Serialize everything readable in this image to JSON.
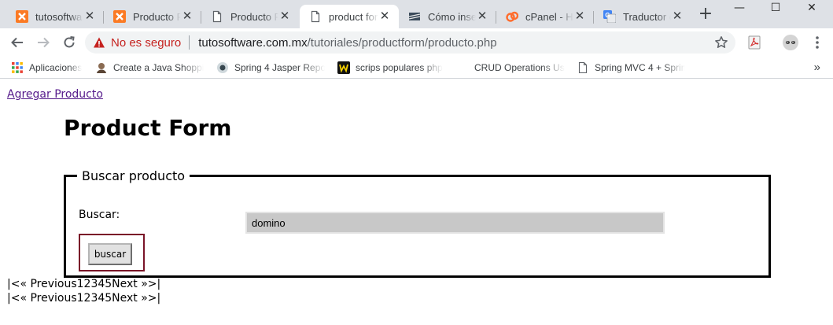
{
  "browser": {
    "tabs": [
      {
        "title": "tutosoftwa",
        "icon": "xampp-icon",
        "active": false
      },
      {
        "title": "Producto F",
        "icon": "xampp-icon",
        "active": false
      },
      {
        "title": "Producto F",
        "icon": "document-icon",
        "active": false
      },
      {
        "title": "product for",
        "icon": "document-icon",
        "active": true
      },
      {
        "title": "Cómo inse",
        "icon": "site-icon",
        "active": false
      },
      {
        "title": "cPanel - Ho",
        "icon": "cpanel-icon",
        "active": false
      },
      {
        "title": "Traductor c",
        "icon": "google-translate-icon",
        "active": false
      }
    ],
    "tab_close_glyph": "✕",
    "new_tab_glyph": "+",
    "window_controls": {
      "minimize": "—",
      "maximize": "☐",
      "close": "✕"
    },
    "omnibox": {
      "security_label": "No es seguro",
      "url_host": "tutosoftware.com.mx",
      "url_path": "/tutoriales/productform/producto.php"
    },
    "bookmarks": [
      {
        "label": "Aplicaciones",
        "icon": "apps-grid-icon"
      },
      {
        "label": "Create a Java Shoppin",
        "icon": "bookmark-favicon-icon"
      },
      {
        "label": "Spring 4 Jasper Repo",
        "icon": "bookmark-favicon-icon"
      },
      {
        "label": "scrips populares php",
        "icon": "bookmark-favicon-icon"
      },
      {
        "label": "CRUD Operations Usi",
        "icon": "bookmark-favicon-icon"
      },
      {
        "label": "Spring MVC 4 + Sprin",
        "icon": "document-icon"
      }
    ],
    "bookmarks_overflow": "»"
  },
  "page": {
    "add_product_link": "Agregar Producto",
    "title": "Product Form",
    "search": {
      "legend": "Buscar producto",
      "label": "Buscar:",
      "value": "domino",
      "button_label": "buscar"
    },
    "pagination": [
      "|<« Previous12345Next »>|",
      "|<« Previous12345Next »>|"
    ]
  },
  "colors": {
    "tabstrip": "#dee1e6",
    "omnibox": "#f1f3f4",
    "insecure_red": "#c5221f",
    "link_visited": "#551a8b",
    "button_frame": "#7a1428",
    "input_bg": "#c8c8c8"
  }
}
